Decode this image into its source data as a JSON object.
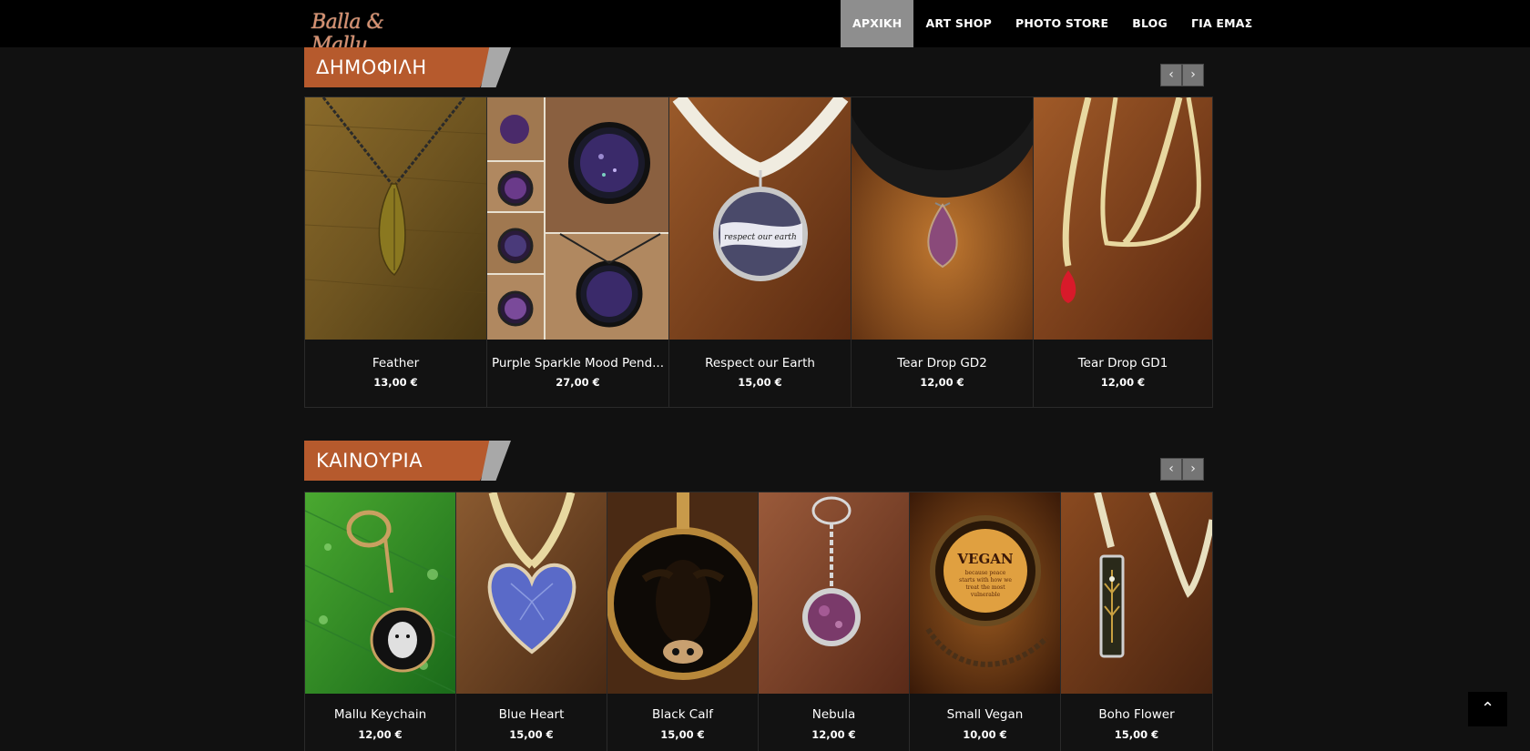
{
  "header": {
    "logo_text": "Balla & Mallu",
    "nav": [
      {
        "label": "ΑΡΧΙΚΗ",
        "active": true
      },
      {
        "label": "ART SHOP",
        "active": false
      },
      {
        "label": "PHOTO STORE",
        "active": false
      },
      {
        "label": "BLOG",
        "active": false
      },
      {
        "label": "ΓΙΑ ΕΜΑΣ",
        "active": false
      }
    ]
  },
  "colors": {
    "accent": "#b65a2d",
    "header_bg": "#000000",
    "page_bg": "#111111",
    "nav_active_bg": "#8e8e8e"
  },
  "icons": {
    "prev": "chevron-left-icon",
    "next": "chevron-right-icon",
    "to_top": "chevron-up-icon"
  },
  "popular": {
    "title": "ΔΗΜΟΦΙΛΗ",
    "prev": "‹",
    "next": "›",
    "products": [
      {
        "name": "Feather",
        "price": "13,00 €"
      },
      {
        "name": "Purple Sparkle Mood Pend...",
        "price": "27,00 €"
      },
      {
        "name": "Respect our Earth",
        "price": "15,00 €"
      },
      {
        "name": "Tear Drop GD2",
        "price": "12,00 €"
      },
      {
        "name": "Tear Drop GD1",
        "price": "12,00 €"
      }
    ]
  },
  "new": {
    "title": "ΚΑΙΝΟΥΡΙΑ",
    "prev": "‹",
    "next": "›",
    "products": [
      {
        "name": "Mallu Keychain",
        "price": "12,00 €"
      },
      {
        "name": "Blue Heart",
        "price": "15,00 €"
      },
      {
        "name": "Black Calf",
        "price": "15,00 €"
      },
      {
        "name": "Nebula",
        "price": "12,00 €"
      },
      {
        "name": "Small Vegan",
        "price": "10,00 €"
      },
      {
        "name": "Boho Flower",
        "price": "15,00 €"
      }
    ]
  },
  "image_text": {
    "respect": "respect our earth",
    "vegan_title": "VEGAN",
    "vegan_line1": "because peace",
    "vegan_line2": "starts with how we",
    "vegan_line3": "treat the most",
    "vegan_line4": "vulnerable"
  },
  "scroll_top": "⌃"
}
